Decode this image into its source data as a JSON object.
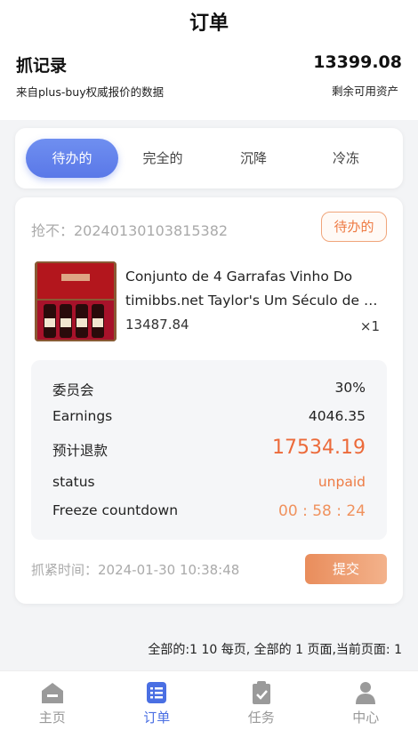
{
  "page": {
    "title": "订单"
  },
  "summary": {
    "title": "抓记录",
    "subtitle": "来自plus-buy权威报价的数据",
    "balance": "13399.08",
    "balance_label": "剩余可用资产"
  },
  "tabs": [
    {
      "label": "待办的",
      "active": true
    },
    {
      "label": "完全的",
      "active": false
    },
    {
      "label": "沉降",
      "active": false
    },
    {
      "label": "冷冻",
      "active": false
    }
  ],
  "order": {
    "number": "抢不：20240130103815382",
    "status": "待办的",
    "product_name": "Conjunto de 4 Garrafas Vinho Do timibbs.net Taylor's Um Século de …",
    "price": "13487.84",
    "quantity": "×1",
    "details": [
      {
        "label": "委员会",
        "value": "30%"
      },
      {
        "label": "Earnings",
        "value": "4046.35"
      },
      {
        "label": "预计退款",
        "value": "17534.19"
      },
      {
        "label": "status",
        "value": "unpaid"
      },
      {
        "label": "Freeze countdown",
        "value": "00 : 58 : 24"
      }
    ],
    "grab_time": "抓紧时间：2024-01-30 10:38:48",
    "submit_label": "提交"
  },
  "pagination": "全部的:1 10 每页, 全部的 1 页面,当前页面: 1",
  "tabbar": [
    {
      "label": "主页",
      "icon": "home-icon",
      "active": false
    },
    {
      "label": "订单",
      "icon": "orders-icon",
      "active": true
    },
    {
      "label": "任务",
      "icon": "tasks-icon",
      "active": false
    },
    {
      "label": "中心",
      "icon": "user-icon",
      "active": false
    }
  ],
  "colors": {
    "accent": "#5a78e8",
    "orange": "#ee7b44",
    "refund": "#ec6a3a",
    "muted": "#aaaaaa"
  }
}
